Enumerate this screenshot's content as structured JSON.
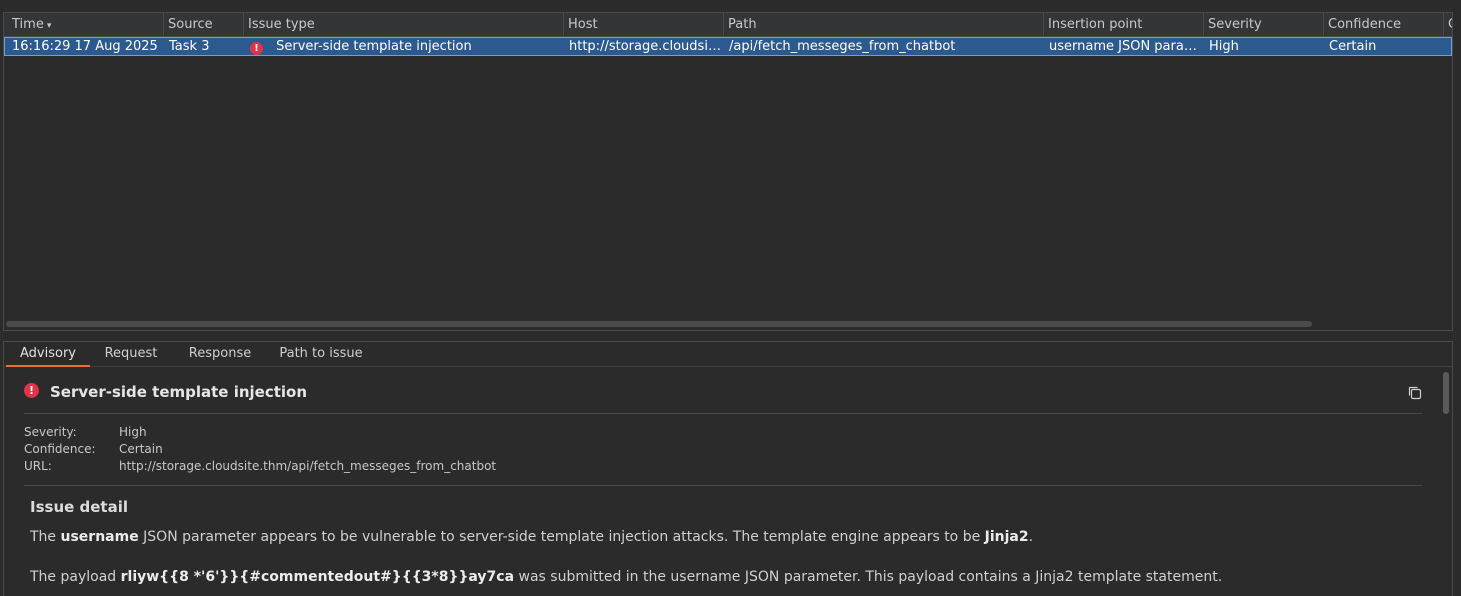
{
  "table": {
    "columns": [
      {
        "label": "Time",
        "sort": "▾"
      },
      {
        "label": "Source"
      },
      {
        "label": "Issue type"
      },
      {
        "label": "Host"
      },
      {
        "label": "Path"
      },
      {
        "label": "Insertion point"
      },
      {
        "label": "Severity"
      },
      {
        "label": "Confidence"
      },
      {
        "label": "C"
      }
    ],
    "rows": [
      {
        "time": "16:16:29 17 Aug 2025",
        "source": "Task 3",
        "issue_type": "Server-side template injection",
        "host": "http://storage.cloudsit...",
        "path": "/api/fetch_messeges_from_chatbot",
        "insertion_point": "username JSON param...",
        "severity": "High",
        "confidence": "Certain"
      }
    ]
  },
  "tabs": [
    "Advisory",
    "Request",
    "Response",
    "Path to issue"
  ],
  "advisory": {
    "icon": "error-icon",
    "title": "Server-side template injection",
    "meta": [
      {
        "key": "Severity:",
        "value": "High"
      },
      {
        "key": "Confidence:",
        "value": "Certain"
      },
      {
        "key": "URL:",
        "value": "http://storage.cloudsite.thm/api/fetch_messeges_from_chatbot"
      }
    ],
    "section_title": "Issue detail",
    "p1": {
      "t1": "The ",
      "b1": "username",
      "t2": " JSON parameter appears to be vulnerable to server-side template injection attacks. The template engine appears to be ",
      "b2": "Jinja2",
      "t3": "."
    },
    "p2": {
      "t1": "The payload ",
      "b1": "rliyw{{8 *'6'}}{#commentedout#}{{3*8}}ay7ca",
      "t2": " was submitted in the username JSON parameter. This payload contains a Jinja2 template statement."
    }
  },
  "colors": {
    "selected_row": "#2d5a8e",
    "error_icon": "#e0344a",
    "active_tab": "#e8702a"
  }
}
